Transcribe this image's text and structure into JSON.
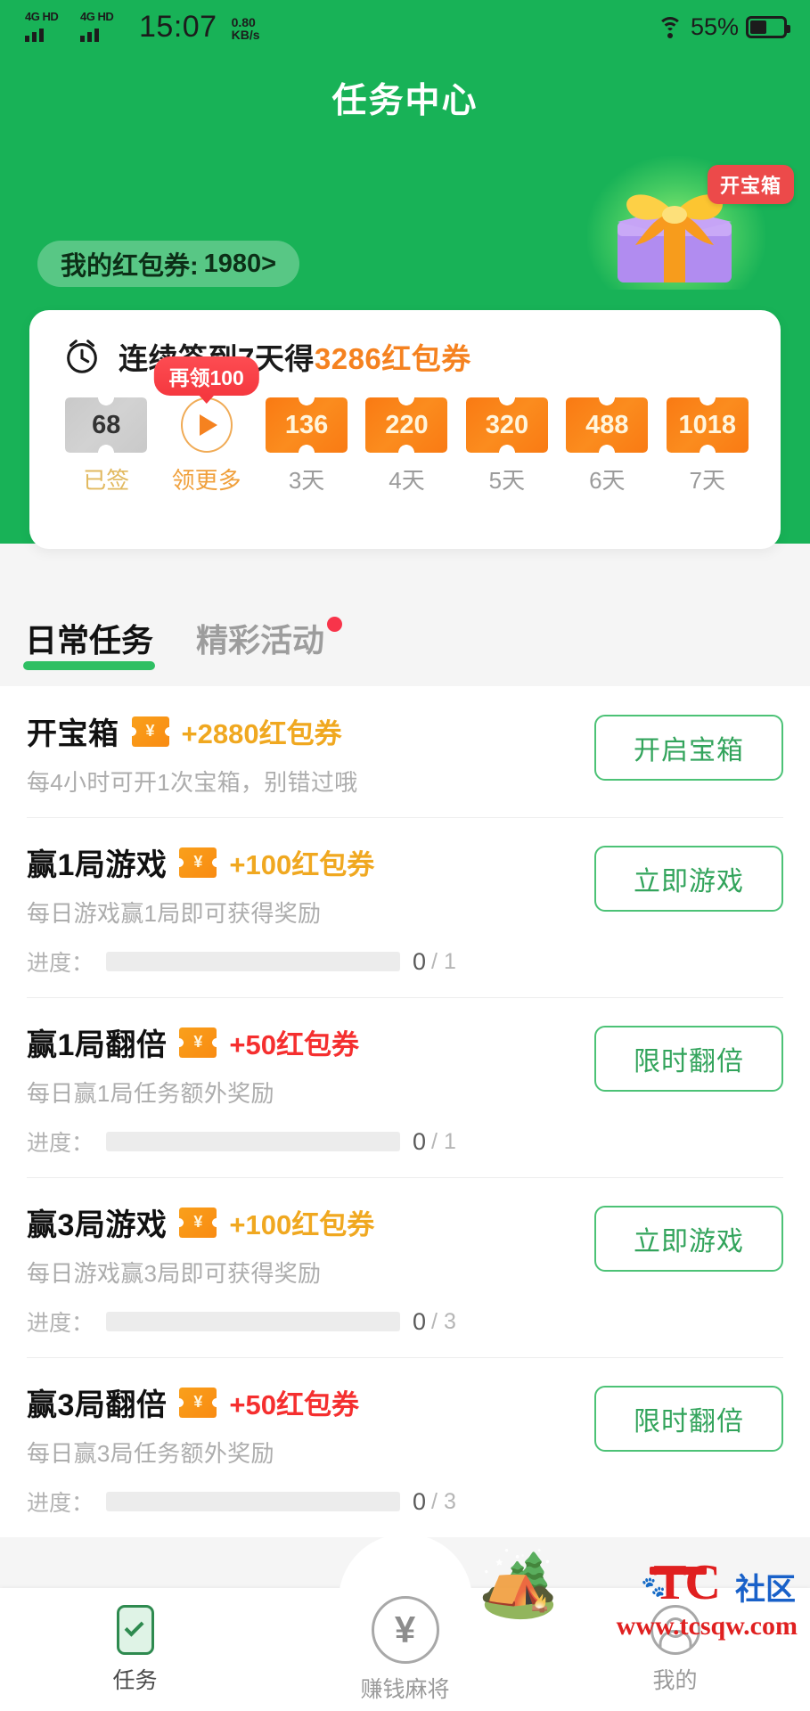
{
  "statusbar": {
    "network_left": "4G HD",
    "network_right": "4G HD",
    "time": "15:07",
    "speed_value": "0.80",
    "speed_unit": "KB/s",
    "battery_percent": "55%",
    "wifi_icon": "wifi-icon",
    "battery_icon": "battery-icon"
  },
  "header": {
    "title": "任务中心",
    "coupon_label": "我的红包券:",
    "coupon_value": "1980>",
    "gift_badge": "开宝箱",
    "gift_icon": "gift-box-icon",
    "bg_color": "#18b257"
  },
  "signin": {
    "clock_icon": "alarm-clock-icon",
    "title_prefix": "连续签到7天得",
    "title_highlight": "3286红包券",
    "more_badge": "再领100",
    "days": [
      {
        "value": "68",
        "label": "已签",
        "state": "signed"
      },
      {
        "value": "play",
        "label": "领更多",
        "state": "more"
      },
      {
        "value": "136",
        "label": "3天",
        "state": "pending"
      },
      {
        "value": "220",
        "label": "4天",
        "state": "pending"
      },
      {
        "value": "320",
        "label": "5天",
        "state": "pending"
      },
      {
        "value": "488",
        "label": "6天",
        "state": "pending"
      },
      {
        "value": "1018",
        "label": "7天",
        "state": "pending"
      }
    ]
  },
  "tabs": [
    {
      "label": "日常任务",
      "active": true,
      "dot": false
    },
    {
      "label": "精彩活动",
      "active": false,
      "dot": true
    }
  ],
  "tasks": [
    {
      "name": "开宝箱",
      "ticket_icon": "coupon-ticket-icon",
      "ticket_symbol": "¥",
      "reward": "+2880红包券",
      "reward_color": "gold",
      "desc": "每4小时可开1次宝箱，别错过哦",
      "button": "开启宝箱",
      "progress": null
    },
    {
      "name": "赢1局游戏",
      "ticket_icon": "coupon-ticket-icon",
      "ticket_symbol": "¥",
      "reward": "+100红包券",
      "reward_color": "gold",
      "desc": "每日游戏赢1局即可获得奖励",
      "button": "立即游戏",
      "progress": {
        "label": "进度：",
        "current": "0",
        "total": "/ 1",
        "percent": 0
      }
    },
    {
      "name": "赢1局翻倍",
      "ticket_icon": "coupon-ticket-icon",
      "ticket_symbol": "¥",
      "reward": "+50红包券",
      "reward_color": "red",
      "desc": "每日赢1局任务额外奖励",
      "button": "限时翻倍",
      "progress": {
        "label": "进度：",
        "current": "0",
        "total": "/ 1",
        "percent": 0
      }
    },
    {
      "name": "赢3局游戏",
      "ticket_icon": "coupon-ticket-icon",
      "ticket_symbol": "¥",
      "reward": "+100红包券",
      "reward_color": "gold",
      "desc": "每日游戏赢3局即可获得奖励",
      "button": "立即游戏",
      "progress": {
        "label": "进度：",
        "current": "0",
        "total": "/ 3",
        "percent": 0
      }
    },
    {
      "name": "赢3局翻倍",
      "ticket_icon": "coupon-ticket-icon",
      "ticket_symbol": "¥",
      "reward": "+50红包券",
      "reward_color": "red",
      "desc": "每日赢3局任务额外奖励",
      "button": "限时翻倍",
      "progress": {
        "label": "进度：",
        "current": "0",
        "total": "/ 3",
        "percent": 0
      }
    }
  ],
  "bottomnav": [
    {
      "label": "任务",
      "icon": "task-checklist-icon",
      "active": true
    },
    {
      "label": "赚钱麻将",
      "icon": "yen-coin-icon",
      "active": false
    },
    {
      "label": "我的",
      "icon": "person-icon",
      "active": false
    }
  ],
  "watermark": {
    "brand": "TC",
    "suffix": "社区",
    "url": "www.tcsqw.com"
  },
  "colors": {
    "brand_green": "#18b257",
    "accent_green": "#2fbf63",
    "reward_gold": "#f0a820",
    "reward_red": "#f52f2f",
    "ticket_orange": "#f98b12",
    "badge_red": "#f5383f"
  }
}
